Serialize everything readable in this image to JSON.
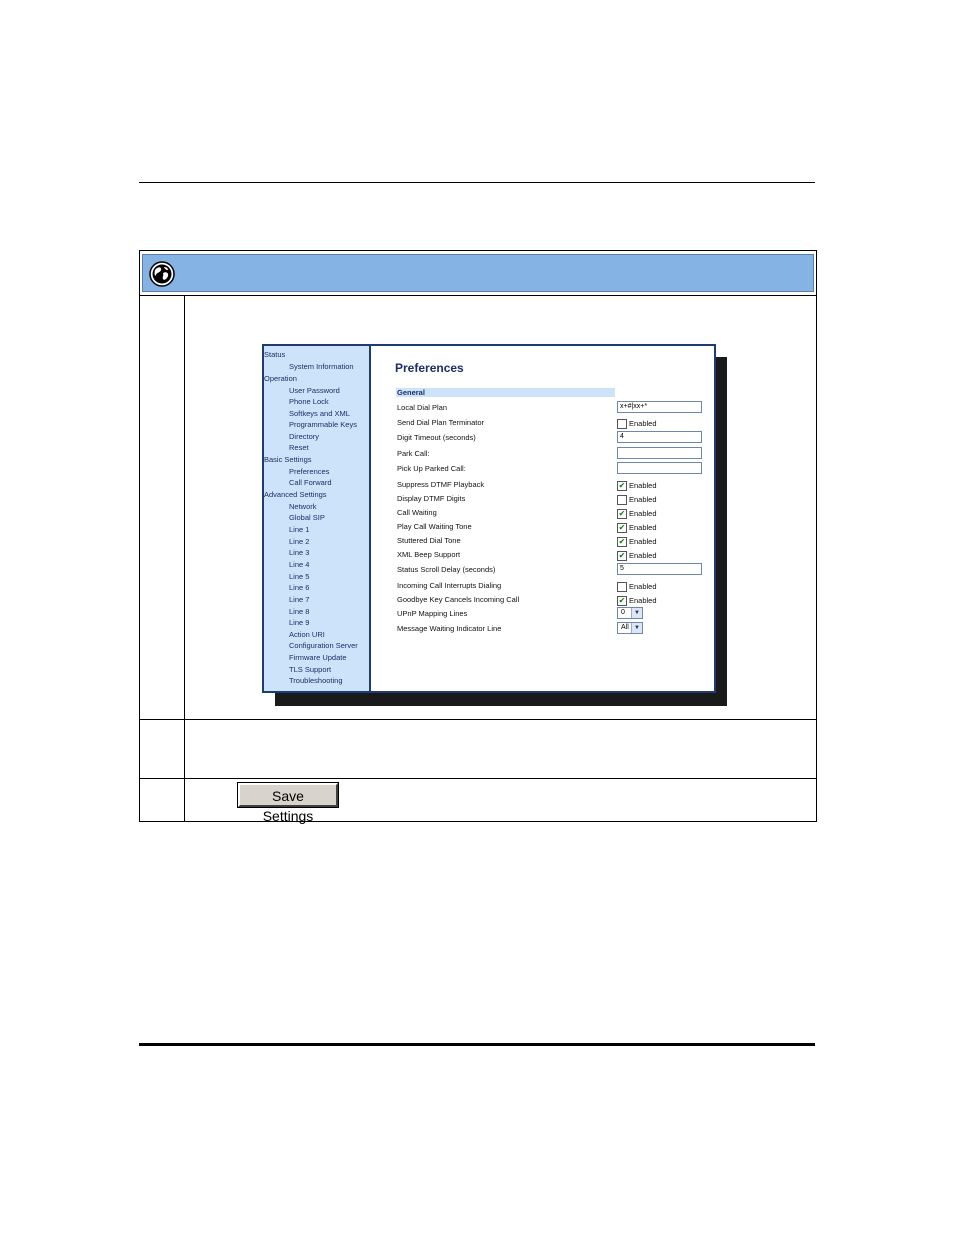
{
  "screenshot": {
    "nav": {
      "items": [
        {
          "label": "Status",
          "type": "header"
        },
        {
          "label": "System Information",
          "type": "sub"
        },
        {
          "label": "Operation",
          "type": "header"
        },
        {
          "label": "User Password",
          "type": "sub"
        },
        {
          "label": "Phone Lock",
          "type": "sub"
        },
        {
          "label": "Softkeys and XML",
          "type": "sub"
        },
        {
          "label": "Programmable Keys",
          "type": "sub"
        },
        {
          "label": "Directory",
          "type": "sub"
        },
        {
          "label": "Reset",
          "type": "sub"
        },
        {
          "label": "Basic Settings",
          "type": "header"
        },
        {
          "label": "Preferences",
          "type": "sub"
        },
        {
          "label": "Call Forward",
          "type": "sub"
        },
        {
          "label": "Advanced Settings",
          "type": "header"
        },
        {
          "label": "Network",
          "type": "sub"
        },
        {
          "label": "Global SIP",
          "type": "sub"
        },
        {
          "label": "Line 1",
          "type": "sub"
        },
        {
          "label": "Line 2",
          "type": "sub"
        },
        {
          "label": "Line 3",
          "type": "sub"
        },
        {
          "label": "Line 4",
          "type": "sub"
        },
        {
          "label": "Line 5",
          "type": "sub"
        },
        {
          "label": "Line 6",
          "type": "sub"
        },
        {
          "label": "Line 7",
          "type": "sub"
        },
        {
          "label": "Line 8",
          "type": "sub"
        },
        {
          "label": "Line 9",
          "type": "sub"
        },
        {
          "label": "Action URI",
          "type": "sub"
        },
        {
          "label": "Configuration Server",
          "type": "sub"
        },
        {
          "label": "Firmware Update",
          "type": "sub"
        },
        {
          "label": "TLS Support",
          "type": "sub"
        },
        {
          "label": "Troubleshooting",
          "type": "sub"
        }
      ]
    },
    "title": "Preferences",
    "section": "General",
    "fields": [
      {
        "label": "Local Dial Plan",
        "control": "text",
        "value": "x+#|xx+*"
      },
      {
        "label": "Send Dial Plan Terminator",
        "control": "checkbox",
        "checked": false,
        "text": "Enabled"
      },
      {
        "label": "Digit Timeout (seconds)",
        "control": "text",
        "value": "4"
      },
      {
        "label": "Park Call:",
        "control": "text",
        "value": ""
      },
      {
        "label": "Pick Up Parked Call:",
        "control": "text",
        "value": ""
      },
      {
        "label": "Suppress DTMF Playback",
        "control": "checkbox",
        "checked": true,
        "text": "Enabled"
      },
      {
        "label": "Display DTMF Digits",
        "control": "checkbox",
        "checked": false,
        "text": "Enabled"
      },
      {
        "label": "Call Waiting",
        "control": "checkbox",
        "checked": true,
        "text": "Enabled"
      },
      {
        "label": "Play Call Waiting Tone",
        "control": "checkbox",
        "checked": true,
        "text": "Enabled"
      },
      {
        "label": "Stuttered Dial Tone",
        "control": "checkbox",
        "checked": true,
        "text": "Enabled"
      },
      {
        "label": "XML Beep Support",
        "control": "checkbox",
        "checked": true,
        "text": "Enabled"
      },
      {
        "label": "Status Scroll Delay (seconds)",
        "control": "text",
        "value": "5"
      },
      {
        "label": "Incoming Call Interrupts Dialing",
        "control": "checkbox",
        "checked": false,
        "text": "Enabled"
      },
      {
        "label": "Goodbye Key Cancels Incoming Call",
        "control": "checkbox",
        "checked": true,
        "text": "Enabled"
      },
      {
        "label": "UPnP Mapping Lines",
        "control": "select",
        "value": "0"
      },
      {
        "label": "Message Waiting Indicator Line",
        "control": "select",
        "value": "All"
      }
    ]
  },
  "save_button": {
    "label": "Save Settings"
  },
  "colors": {
    "header_bar": "#85b4e4",
    "nav_bg": "#cde3fa",
    "accent": "#1e3b72"
  },
  "icons": {
    "header": "globe-icon",
    "check": "checkmark-icon",
    "dropdown": "chevron-down-icon"
  }
}
